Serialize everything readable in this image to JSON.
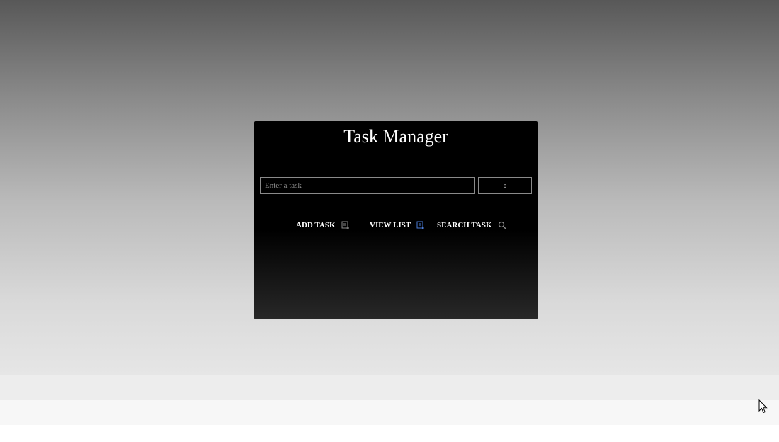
{
  "app": {
    "title": "Task Manager"
  },
  "form": {
    "task_placeholder": "Enter a task",
    "task_value": "",
    "time_display": "--:--"
  },
  "buttons": {
    "add_task": {
      "label": "ADD TASK",
      "icon": "add-task-icon"
    },
    "view_list": {
      "label": "VIEW LIST",
      "icon": "list-icon"
    },
    "search_task": {
      "label": "SEARCH TASK",
      "icon": "search-icon"
    }
  },
  "colors": {
    "panel_background": "#000000",
    "text": "#ffffff",
    "input_border": "#8a8a8a",
    "view_list_icon_accent": "#4a7bd8"
  }
}
